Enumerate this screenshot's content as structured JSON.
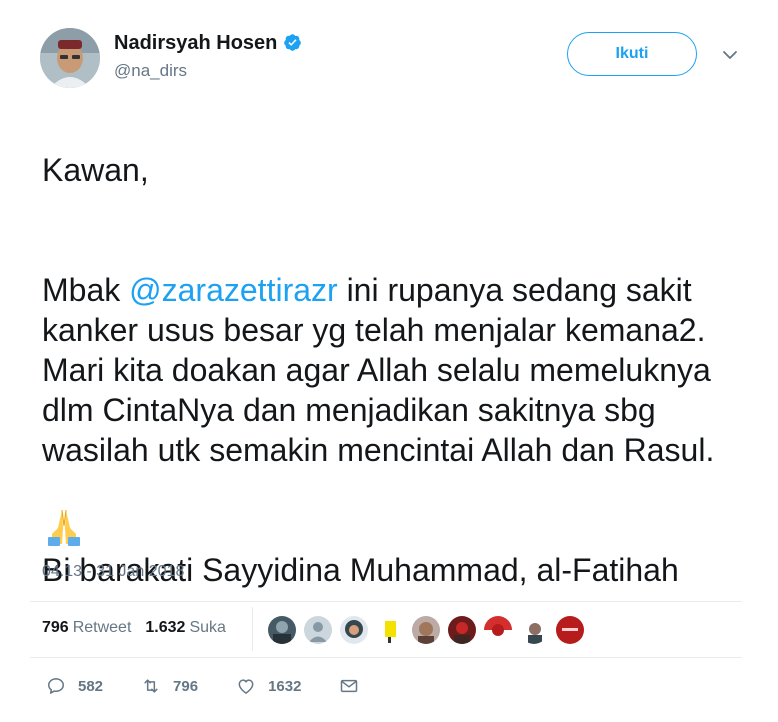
{
  "author": {
    "name": "Nadirsyah Hosen",
    "handle": "@na_dirs",
    "verified_icon": "verified-badge-icon"
  },
  "follow_button": {
    "label": "Ikuti"
  },
  "tweet": {
    "greeting": "Kawan,",
    "para2_prefix": "Mbak ",
    "mention": "@zarazettirazr",
    "para2_rest": " ini rupanya sedang sakit kanker usus besar yg telah menjalar kemana2. Mari kita doakan agar Allah selalu memeluknya dlm CintaNya dan menjadikan sakitnya sbg wasilah utk semakin mencintai Allah dan Rasul.",
    "para3": "Bi barakati Sayyidina Muhammad, al-Fatihah",
    "emoji": "folded-hands-emoji"
  },
  "timestamp": "04.13 - 31 Jan 2018",
  "stats": {
    "retweets_count": "796",
    "retweets_label": "Retweet",
    "likes_count": "1.632",
    "likes_label": "Suka"
  },
  "actions": {
    "reply_count": "582",
    "retweet_count": "796",
    "like_count": "1632"
  },
  "colors": {
    "accent": "#1da1f2",
    "text": "#14171a",
    "secondary": "#657786",
    "divider": "#e6ecf0"
  }
}
